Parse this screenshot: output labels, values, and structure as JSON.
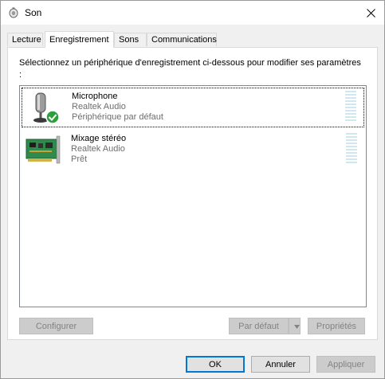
{
  "window": {
    "title": "Son",
    "close_glyph": "✕"
  },
  "tabs": [
    {
      "label": "Lecture",
      "active": false
    },
    {
      "label": "Enregistrement",
      "active": true
    },
    {
      "label": "Sons",
      "active": false
    },
    {
      "label": "Communications",
      "active": false
    }
  ],
  "panel": {
    "instruction": "Sélectionnez un périphérique d'enregistrement ci-dessous pour modifier ses paramètres :"
  },
  "devices": [
    {
      "name": "Microphone",
      "driver": "Realtek Audio",
      "status": "Périphérique par défaut",
      "icon": "microphone-icon",
      "default": true,
      "selected": true
    },
    {
      "name": "Mixage stéréo",
      "driver": "Realtek Audio",
      "status": "Prêt",
      "icon": "sound-card-icon",
      "default": false,
      "selected": false
    }
  ],
  "panel_buttons": {
    "configure": "Configurer",
    "set_default": "Par défaut",
    "properties": "Propriétés"
  },
  "dialog_buttons": {
    "ok": "OK",
    "cancel": "Annuler",
    "apply": "Appliquer"
  },
  "colors": {
    "accent": "#0078d7",
    "check": "#2e9e3e",
    "meter": "#d0e7ef"
  }
}
